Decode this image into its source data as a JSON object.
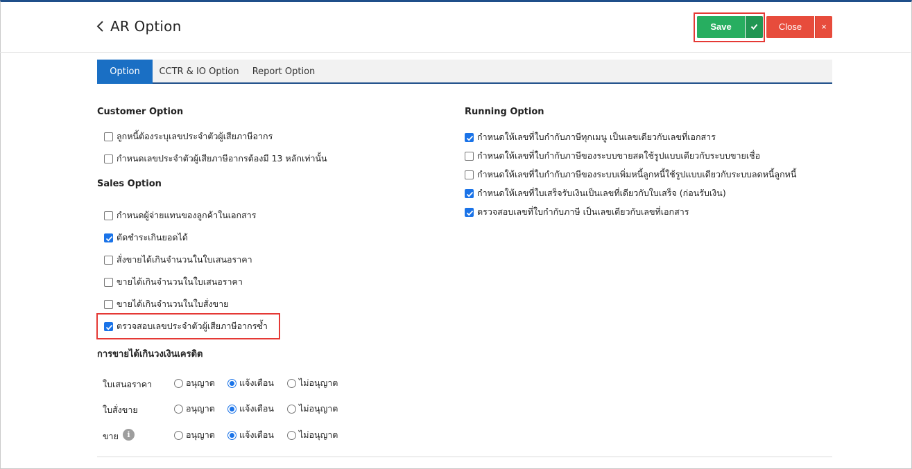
{
  "header": {
    "title": "AR Option",
    "save_label": "Save",
    "close_label": "Close",
    "close_icon": "×"
  },
  "tabs": [
    {
      "label": "Option",
      "active": true
    },
    {
      "label": "CCTR & IO Option",
      "active": false
    },
    {
      "label": "Report Option",
      "active": false
    }
  ],
  "customer_option": {
    "title": "Customer Option",
    "items": [
      {
        "label": "ลูกหนี้ต้องระบุเลขประจำตัวผู้เสียภาษีอากร",
        "checked": false
      },
      {
        "label": "กำหนดเลขประจำตัวผู้เสียภาษีอากรต้องมี 13 หลักเท่านั้น",
        "checked": false
      }
    ]
  },
  "sales_option": {
    "title": "Sales Option",
    "items": [
      {
        "label": "กำหนดผู้จ่ายแทนของลูกค้าในเอกสาร",
        "checked": false
      },
      {
        "label": "ตัดชำระเกินยอดได้",
        "checked": true
      },
      {
        "label": "สั่งขายได้เกินจำนวนในใบเสนอราคา",
        "checked": false
      },
      {
        "label": "ขายได้เกินจำนวนในใบเสนอราคา",
        "checked": false
      },
      {
        "label": "ขายได้เกินจำนวนในใบสั่งขาย",
        "checked": false
      },
      {
        "label": "ตรวจสอบเลขประจำตัวผู้เสียภาษีอากรซ้ำ",
        "checked": true
      }
    ]
  },
  "credit_limit": {
    "title": "การขายได้เกินวงเงินเครดิต",
    "options": [
      "อนุญาต",
      "แจ้งเตือน",
      "ไม่อนุญาต"
    ],
    "rows": [
      {
        "label": "ใบเสนอราคา",
        "selected": "แจ้งเตือน"
      },
      {
        "label": "ใบสั่งขาย",
        "selected": "แจ้งเตือน"
      },
      {
        "label": "ขาย",
        "selected": "แจ้งเตือน",
        "info_icon": "i"
      }
    ]
  },
  "running_option": {
    "title": "Running Option",
    "items": [
      {
        "label": "กำหนดให้เลขที่ใบกำกับภาษีทุกเมนู เป็นเลขเดียวกับเลขที่เอกสาร",
        "checked": true
      },
      {
        "label": "กำหนดให้เลขที่ใบกำกับภาษีของระบบขายสดใช้รูปแบบเดียวกับระบบขายเชื่อ",
        "checked": false
      },
      {
        "label": "กำหนดให้เลขที่ใบกำกับภาษีของระบบเพิ่มหนี้ลูกหนี้ใช้รูปแบบเดียวกับระบบลดหนี้ลูกหนี้",
        "checked": false
      },
      {
        "label": "กำหนดให้เลขที่ใบเสร็จรับเงินเป็นเลขที่เดียวกับใบเสร็จ (ก่อนรับเงิน)",
        "checked": true
      },
      {
        "label": "ตรวจสอบเลขที่ใบกำกับภาษี เป็นเลขเดียวกับเลขที่เอกสาร",
        "checked": true
      }
    ]
  },
  "colors": {
    "save": "#27ae60",
    "close": "#e74c3c",
    "tab_active": "#1a6fc4",
    "checkbox": "#1a73e8",
    "highlight": "#e53935"
  }
}
